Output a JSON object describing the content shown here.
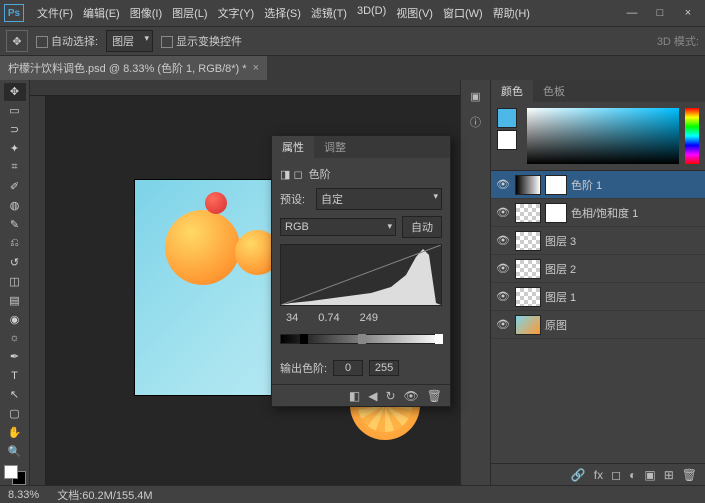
{
  "app_logo": "Ps",
  "menu": [
    "文件(F)",
    "编辑(E)",
    "图像(I)",
    "图层(L)",
    "文字(Y)",
    "选择(S)",
    "滤镜(T)",
    "3D(D)",
    "视图(V)",
    "窗口(W)",
    "帮助(H)"
  ],
  "window_controls": {
    "min": "—",
    "max": "□",
    "close": "×"
  },
  "options_bar": {
    "auto_select_label": "自动选择:",
    "auto_select_target": "图层",
    "show_transform_label": "显示变换控件",
    "mode_label": "3D 模式:"
  },
  "document_tab": {
    "title": "柠檬汁饮料调色.psd @ 8.33% (色阶 1, RGB/8*) *",
    "close": "×"
  },
  "color_panel": {
    "tabs": [
      "颜色",
      "色板"
    ]
  },
  "properties_panel": {
    "tabs": [
      "属性",
      "调整"
    ],
    "type_label": "色阶",
    "preset_label": "预设:",
    "preset_value": "自定",
    "channel_value": "RGB",
    "auto_button": "自动",
    "input_levels": {
      "shadow": "34",
      "mid": "0.74",
      "highlight": "249"
    },
    "output_label": "输出色阶:",
    "output_levels": {
      "low": "0",
      "high": "255"
    }
  },
  "layers": [
    {
      "name": "色阶 1",
      "thumb": "gradient",
      "mask": true,
      "visible": true,
      "active": true
    },
    {
      "name": "色相/饱和度 1",
      "thumb": "check",
      "mask": true,
      "visible": true
    },
    {
      "name": "图层 3",
      "thumb": "check",
      "visible": true
    },
    {
      "name": "图层 2",
      "thumb": "check",
      "visible": true
    },
    {
      "name": "图层 1",
      "thumb": "check",
      "visible": true
    },
    {
      "name": "原图",
      "thumb": "img",
      "visible": true
    }
  ],
  "status": {
    "zoom": "8.33%",
    "doc_info": "文档:60.2M/155.4M"
  },
  "icons": {
    "move": "✥",
    "marquee": "▭",
    "lasso": "⊃",
    "wand": "✦",
    "crop": "⌗",
    "eyedrop": "✐",
    "heal": "◍",
    "brush": "✎",
    "stamp": "⎌",
    "history": "↺",
    "eraser": "◫",
    "gradient": "▤",
    "blur": "◉",
    "dodge": "☼",
    "pen": "✒",
    "type": "T",
    "path": "↖",
    "shape": "▢",
    "hand": "✋",
    "zoom": "🔍",
    "layers_icon": "▣",
    "adjust_icon": "◐",
    "levels_icon": "☰",
    "eye": "👁",
    "link": "🔗",
    "fx": "fx",
    "mask_icon": "◻",
    "new": "⊞",
    "trash": "🗑",
    "reset": "↻",
    "view": "👁",
    "prev": "◀",
    "clip": "◧"
  }
}
